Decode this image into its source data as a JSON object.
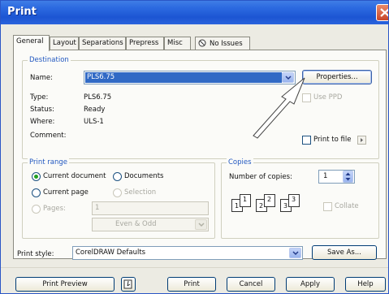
{
  "window": {
    "title": "Print"
  },
  "tabs": [
    {
      "label": "General",
      "active": true
    },
    {
      "label": "Layout"
    },
    {
      "label": "Separations"
    },
    {
      "label": "Prepress"
    },
    {
      "label": "Misc"
    },
    {
      "label": "No Issues",
      "icon": "no-issues-icon"
    }
  ],
  "destination": {
    "group_label": "Destination",
    "name_label": "Name:",
    "name_value": "PLS6.75",
    "properties_button": "Properties...",
    "type_label": "Type:",
    "type_value": "PLS6.75",
    "status_label": "Status:",
    "status_value": "Ready",
    "where_label": "Where:",
    "where_value": "ULS-1",
    "comment_label": "Comment:",
    "use_ppd_label": "Use PPD",
    "print_to_file_label": "Print to file"
  },
  "print_range": {
    "group_label": "Print range",
    "current_document": "Current document",
    "documents": "Documents",
    "current_page": "Current page",
    "selection": "Selection",
    "pages_label": "Pages:",
    "pages_value": "1",
    "even_odd_value": "Even & Odd"
  },
  "copies": {
    "group_label": "Copies",
    "number_label": "Number of copies:",
    "number_value": "1",
    "collate_label": "Collate",
    "page_icon_numbers": [
      "1",
      "1",
      "2",
      "2",
      "3",
      "3"
    ]
  },
  "print_style": {
    "label": "Print style:",
    "value": "CorelDRAW Defaults",
    "save_as_button": "Save As..."
  },
  "footer": {
    "print_preview": "Print Preview",
    "print": "Print",
    "cancel": "Cancel",
    "apply": "Apply",
    "help": "Help"
  },
  "colors": {
    "title_bar": "#2c6ae0",
    "selection": "#316ac5",
    "group_label": "#2258c0",
    "radio_dot": "#21a121"
  }
}
